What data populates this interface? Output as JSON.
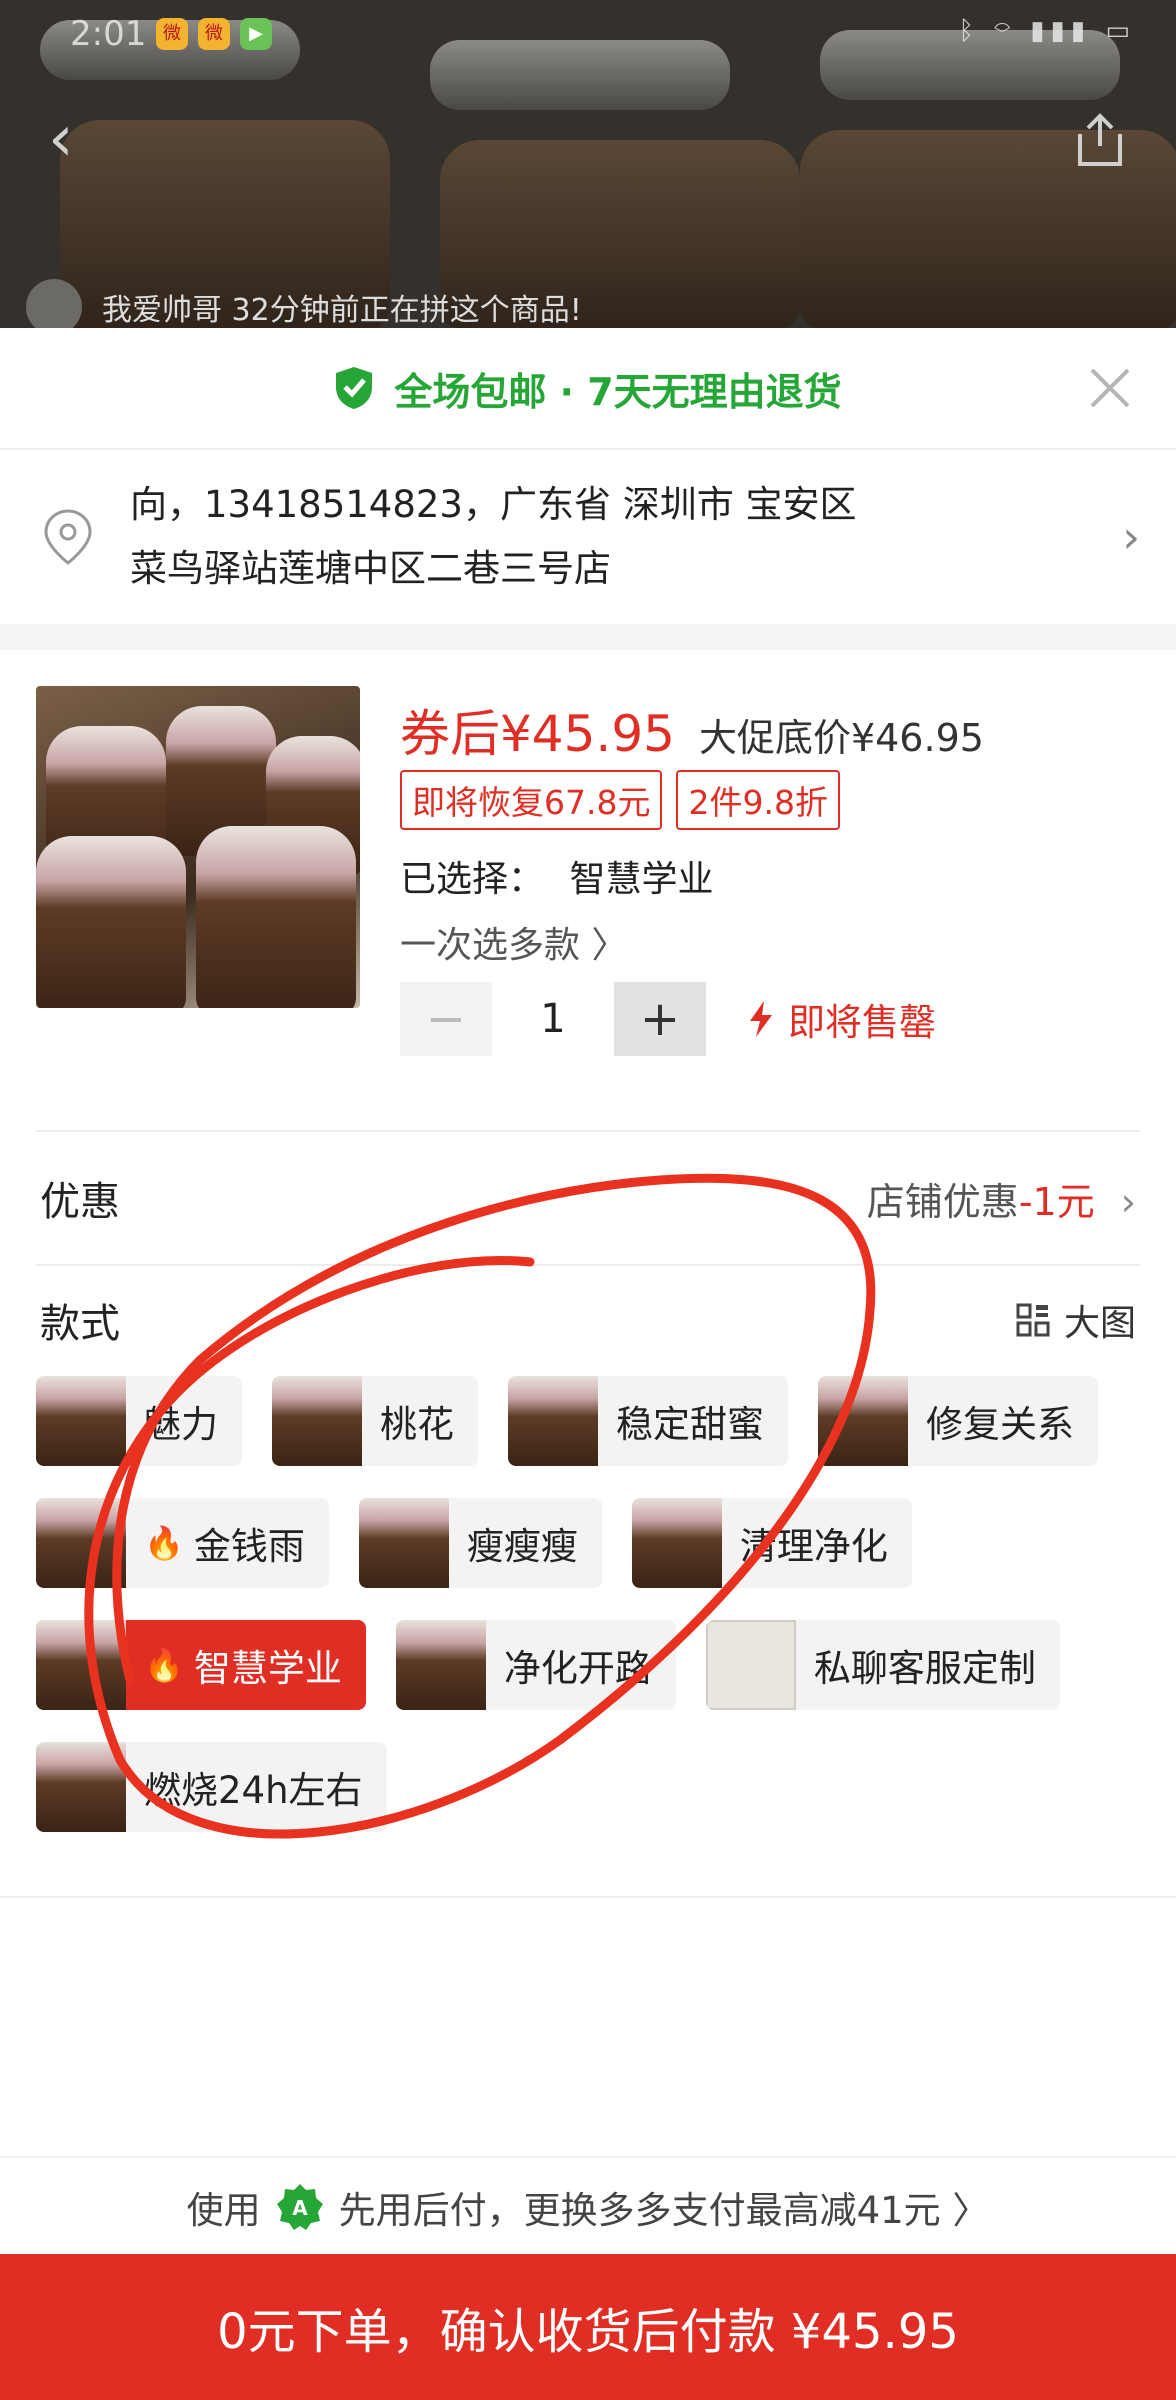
{
  "status_bar": {
    "time": "2:01",
    "apps": [
      "weibo-icon",
      "weibo-icon",
      "video-icon",
      "notification-icon"
    ],
    "right_icons": "ᛒ ⌔ ▮▮▮ ▭"
  },
  "background": {
    "ticker_text": "我爱帅哥 32分钟前正在拼这个商品!"
  },
  "benefit": {
    "text": "全场包邮 · 7天无理由退货",
    "color": "#27a638"
  },
  "address": {
    "line1": "向，13418514823，广东省 深圳市 宝安区",
    "line2": "菜鸟驿站莲塘中区二巷三号店"
  },
  "product": {
    "price_main": "券后¥45.95",
    "price_aux": "大促底价¥46.95",
    "tags": [
      "即将恢复67.8元",
      "2件9.8折"
    ],
    "selected_label": "已选择：",
    "selected_value": "智慧学业",
    "multi_select": "一次选多款 〉",
    "quantity": "1",
    "minus": "−",
    "plus": "+",
    "stock_alert": "即将售罄"
  },
  "discount": {
    "label": "优惠",
    "text": "店铺优惠",
    "amount": "-1元"
  },
  "styles": {
    "label": "款式",
    "big_image": "大图",
    "options": [
      {
        "name": "魅力",
        "hot": false,
        "active": false
      },
      {
        "name": "桃花",
        "hot": false,
        "active": false
      },
      {
        "name": "稳定甜蜜",
        "hot": false,
        "active": false
      },
      {
        "name": "修复关系",
        "hot": false,
        "active": false
      },
      {
        "name": "金钱雨",
        "hot": true,
        "active": false
      },
      {
        "name": "瘦瘦瘦",
        "hot": false,
        "active": false
      },
      {
        "name": "清理净化",
        "hot": false,
        "active": false
      },
      {
        "name": "智慧学业",
        "hot": true,
        "active": true
      },
      {
        "name": "净化开路",
        "hot": false,
        "active": false
      },
      {
        "name": "私聊客服定制",
        "hot": false,
        "active": false
      },
      {
        "name": "燃烧24h左右",
        "hot": false,
        "active": false
      }
    ]
  },
  "pay_tip": {
    "prefix": "使用",
    "text": "先用后付，更换多多支付最高减41元 〉"
  },
  "cta": {
    "label": "0元下单，确认收货后付款 ¥45.95"
  },
  "colors": {
    "accent": "#e02e24",
    "green": "#27a638",
    "annotation": "#e8321f"
  }
}
